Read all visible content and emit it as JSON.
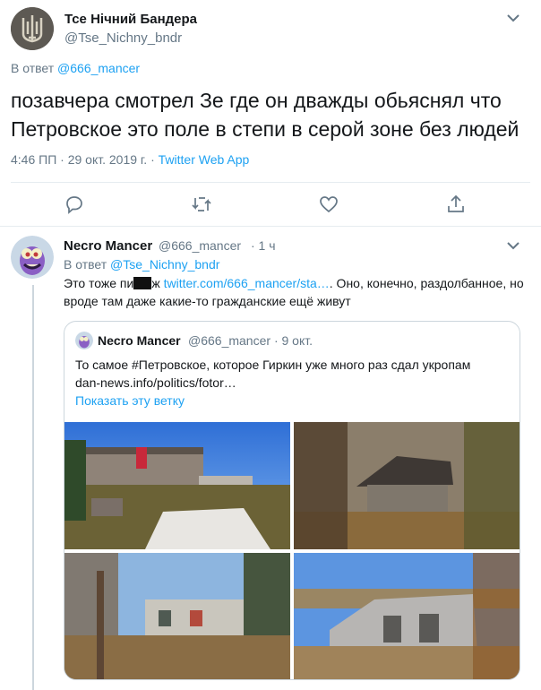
{
  "main_tweet": {
    "name": "Тсе Нічний Бандера",
    "handle": "@Tse_Nichny_bndr",
    "replying_prefix": "В ответ",
    "replying_to": "@666_mancer",
    "text": "позавчера смотрел Зе где он дважды обьяснял что Петровское это поле в степи в серой зоне без людей",
    "time": "4:46 ПП · 29 окт. 2019 г. · ",
    "source": "Twitter Web App"
  },
  "reply_tweet": {
    "name": "Necro Mancer",
    "handle": "@666_mancer",
    "time": "· 1 ч",
    "replying_prefix": "В ответ",
    "replying_to": "@Tse_Nichny_bndr",
    "text_pre": "Это тоже пи",
    "text_mid": "ж ",
    "link": "twitter.com/666_mancer/sta…",
    "text_post": ". Оно, конечно, раздолбанное, но вроде там даже какие-то гражданские ещё живут"
  },
  "quoted_tweet": {
    "name": "Necro Mancer",
    "handle": "@666_mancer",
    "time": "· 9 окт.",
    "text_line1": "То самое #Петровское, которое Гиркин уже много раз сдал укропам",
    "text_line2": "dan-news.info/politics/fotor…",
    "show_thread": "Показать эту ветку"
  },
  "icons": {
    "avatar_main": "trident-coat-of-arms-avatar",
    "avatar_reply": "purple-monster-avatar",
    "actions": [
      "reply-icon",
      "retweet-icon",
      "like-icon",
      "share-icon"
    ],
    "menu": "chevron-down-icon"
  },
  "colors": {
    "accent": "#1da1f2",
    "muted": "#657786",
    "border": "#e6ecf0"
  }
}
